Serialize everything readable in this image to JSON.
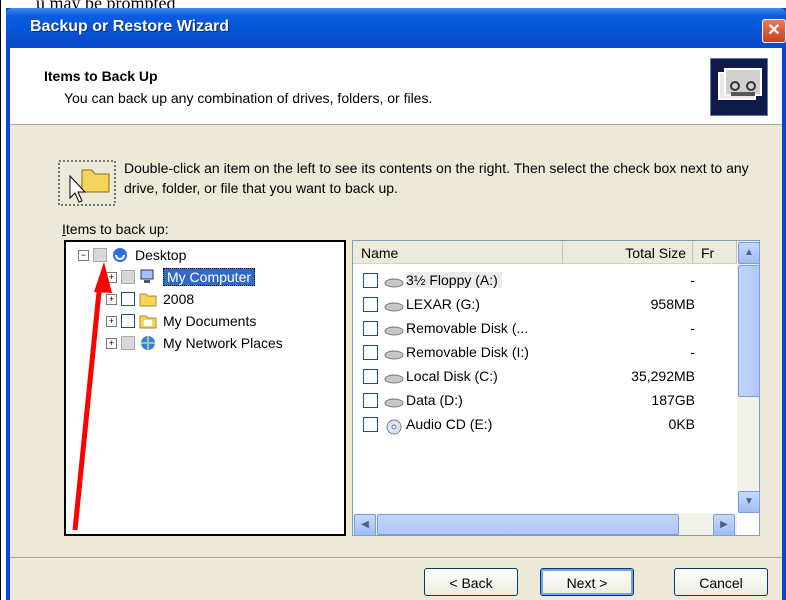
{
  "top_text": "u may be prompted",
  "window": {
    "title": "Backup or Restore Wizard",
    "close_glyph": "✕"
  },
  "header": {
    "title": "Items to Back Up",
    "subtitle": "You can back up any combination of drives, folders, or files."
  },
  "instruction": "Double-click an item on the left to see its contents on the right. Then select the check box next to any drive, folder, or file that you want to back up.",
  "items_label": {
    "accel": "I",
    "rest": "tems to back up:"
  },
  "tree": [
    {
      "label": "Desktop",
      "expander": "−",
      "icon": "desktop-icon"
    },
    {
      "label": "My Computer",
      "expander": "+",
      "icon": "computer-icon",
      "selected": true
    },
    {
      "label": "2008",
      "expander": "+",
      "icon": "folder-icon"
    },
    {
      "label": "My Documents",
      "expander": "+",
      "icon": "folder-icon"
    },
    {
      "label": "My Network Places",
      "expander": "+",
      "icon": "network-icon"
    }
  ],
  "list": {
    "columns": [
      "Name",
      "Total Size",
      "Fr"
    ],
    "rows": [
      {
        "name": "3½ Floppy (A:)",
        "size": "-"
      },
      {
        "name": "LEXAR (G:)",
        "size": "958MB"
      },
      {
        "name": "Removable Disk (...",
        "size": "-"
      },
      {
        "name": "Removable Disk (I:)",
        "size": "-"
      },
      {
        "name": "Local Disk (C:)",
        "size": "35,292MB"
      },
      {
        "name": "Data (D:)",
        "size": "187GB"
      },
      {
        "name": "Audio CD (E:)",
        "size": "0KB"
      }
    ]
  },
  "buttons": {
    "back": "< Back",
    "back_accel": "B",
    "next": "Next >",
    "next_accel": "N",
    "cancel": "Cancel"
  },
  "colors": {
    "title_blue": "#0a46d6",
    "client": "#ece9d8",
    "selection": "#316ac5",
    "annotation_arrow": "#ff0000"
  }
}
